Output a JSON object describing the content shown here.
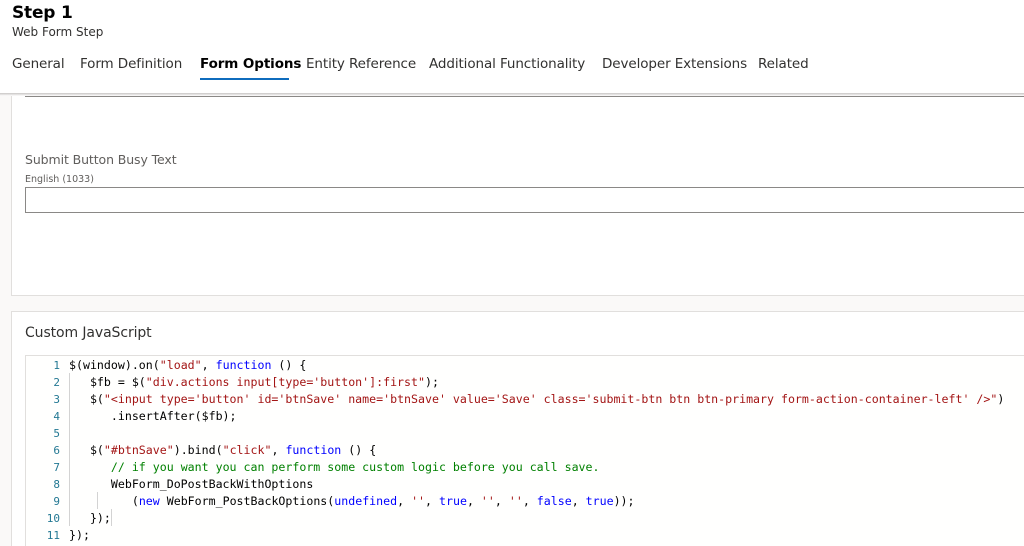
{
  "header": {
    "title": "Step 1",
    "subtitle": "Web Form Step"
  },
  "tabs": [
    {
      "label": "General",
      "active": false
    },
    {
      "label": "Form Definition",
      "active": false
    },
    {
      "label": "Form Options",
      "active": true
    },
    {
      "label": "Entity Reference",
      "active": false
    },
    {
      "label": "Additional Functionality",
      "active": false
    },
    {
      "label": "Developer Extensions",
      "active": false
    },
    {
      "label": "Related",
      "active": false
    }
  ],
  "busy_text_field": {
    "label": "Submit Button Busy Text",
    "language": "English (1033)",
    "value": ""
  },
  "custom_js": {
    "title": "Custom JavaScript",
    "lines": [
      {
        "n": "1",
        "tokens": [
          {
            "t": "$(window).on("
          },
          {
            "t": "\"load\"",
            "c": "str"
          },
          {
            "t": ", "
          },
          {
            "t": "function",
            "c": "kw"
          },
          {
            "t": " () {"
          }
        ]
      },
      {
        "n": "2",
        "tokens": [
          {
            "t": "   $fb = $("
          },
          {
            "t": "\"div.actions input[type='button']:first\"",
            "c": "str"
          },
          {
            "t": ");"
          }
        ]
      },
      {
        "n": "3",
        "tokens": [
          {
            "t": "   $("
          },
          {
            "t": "\"<input type='button' id='btnSave' name='btnSave' value='Save' class='submit-btn btn btn-primary form-action-container-left' />\"",
            "c": "str"
          },
          {
            "t": ")"
          }
        ]
      },
      {
        "n": "4",
        "tokens": [
          {
            "t": "      .insertAfter($fb);"
          }
        ]
      },
      {
        "n": "5",
        "tokens": [
          {
            "t": ""
          }
        ]
      },
      {
        "n": "6",
        "tokens": [
          {
            "t": "   $("
          },
          {
            "t": "\"#btnSave\"",
            "c": "str"
          },
          {
            "t": ").bind("
          },
          {
            "t": "\"click\"",
            "c": "str"
          },
          {
            "t": ", "
          },
          {
            "t": "function",
            "c": "kw"
          },
          {
            "t": " () {"
          }
        ]
      },
      {
        "n": "7",
        "tokens": [
          {
            "t": "      "
          },
          {
            "t": "// if you want you can perform some custom logic before you call save.",
            "c": "cm"
          }
        ]
      },
      {
        "n": "8",
        "tokens": [
          {
            "t": "      WebForm_DoPostBackWithOptions"
          }
        ]
      },
      {
        "n": "9",
        "tokens": [
          {
            "t": "         ("
          },
          {
            "t": "new",
            "c": "kw"
          },
          {
            "t": " WebForm_PostBackOptions("
          },
          {
            "t": "undefined",
            "c": "kw"
          },
          {
            "t": ", "
          },
          {
            "t": "''",
            "c": "str"
          },
          {
            "t": ", "
          },
          {
            "t": "true",
            "c": "kw"
          },
          {
            "t": ", "
          },
          {
            "t": "''",
            "c": "str"
          },
          {
            "t": ", "
          },
          {
            "t": "''",
            "c": "str"
          },
          {
            "t": ", "
          },
          {
            "t": "false",
            "c": "kw"
          },
          {
            "t": ", "
          },
          {
            "t": "true",
            "c": "kw"
          },
          {
            "t": "));"
          }
        ]
      },
      {
        "n": "10",
        "tokens": [
          {
            "t": "   });"
          }
        ]
      },
      {
        "n": "11",
        "tokens": [
          {
            "t": "});"
          }
        ]
      }
    ]
  },
  "colors": {
    "accent": "#0f6cbd",
    "string": "#a31515",
    "keyword": "#0000ff",
    "comment": "#008000",
    "line_number": "#237893"
  }
}
